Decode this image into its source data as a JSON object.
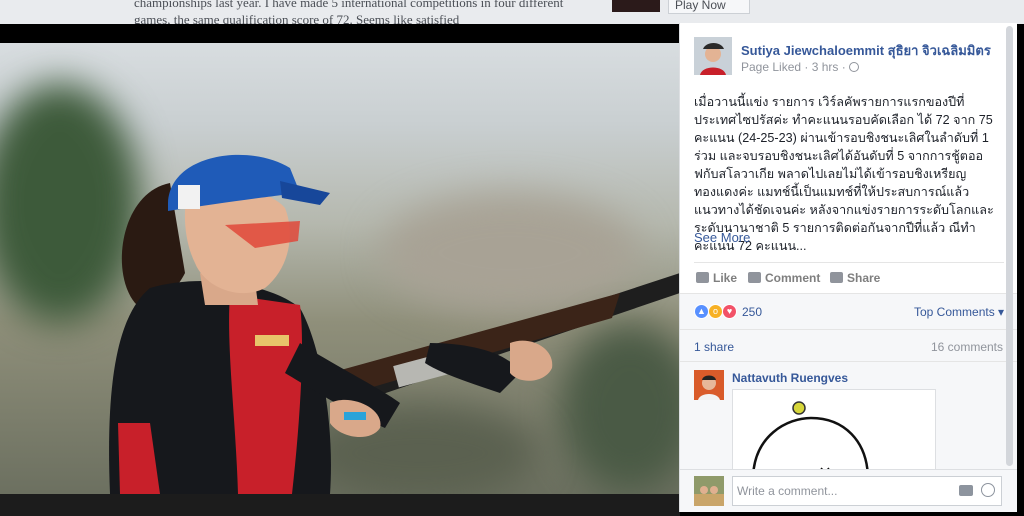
{
  "background_page": {
    "article_text": "championships last year. I have made 5 international competitions in four different games, the same qualification score of 72. Seems like satisfied",
    "play_label": "Play Now"
  },
  "post": {
    "author": "Sutiya Jiewchaloemmit สุธิยา จิวเฉลิมมิตร",
    "meta": "Page Liked · 3 hrs ·",
    "text": "เมื่อวานนี้แข่ง รายการ เวิร์ลคัพรายการแรกของปีที่ประเทศไซปรัสค่ะ ทำคะแนนรอบคัดเลือก ได้ 72 จาก 75 คะแนน (24-25-23) ผ่านเข้ารอบชิงชนะเลิศในลำดับที่ 1 ร่วม และจบรอบชิงชนะเลิศได้อันดับที่ 5 จากการชู้ตออฟกับสโลวาเกีย พลาดไปเลยไม่ได้เข้ารอบชิงเหรียญทองแดงค่ะ แมทช์นี้เป็นแมทช์ที่ให้ประสบการณ์แล้วแนวทางได้ชัดเจนค่ะ หลังจากแข่งรายการระดับโลกและระดับนานาชาติ 5 รายการติดต่อกันจากปีที่แล้ว ณีทำคะแนน 72 คะแนน...",
    "see_more": "See More"
  },
  "actions": {
    "like": "Like",
    "comment": "Comment",
    "share": "Share"
  },
  "reactions": {
    "count": "250",
    "top_comments": "Top Comments ▾"
  },
  "stats": {
    "shares": "1 share",
    "comments": "16 comments"
  },
  "first_comment": {
    "author": "Nattavuth Ruengves"
  },
  "composer": {
    "placeholder": "Write a comment..."
  },
  "colors": {
    "link": "#365899",
    "like": "#5890ff",
    "love": "#f25268",
    "wow": "#f7b125"
  }
}
